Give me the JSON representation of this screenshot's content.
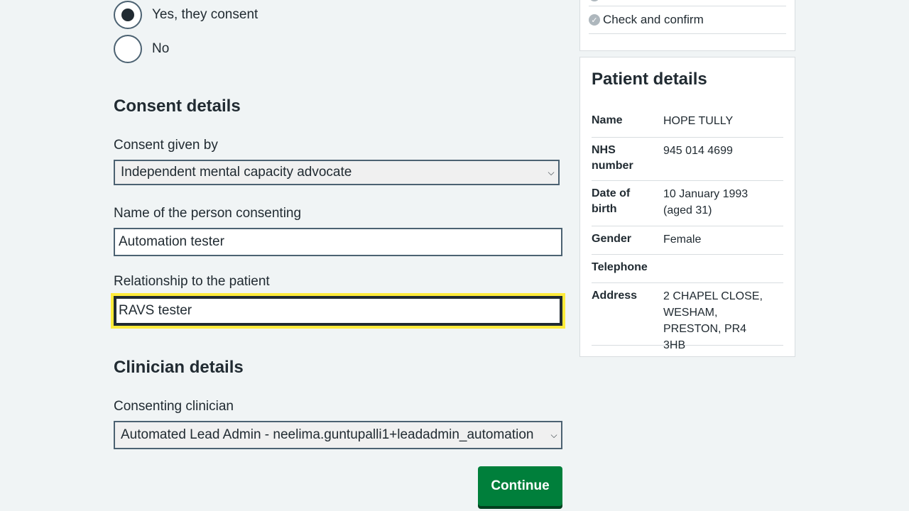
{
  "consent_options": [
    {
      "label": "Yes, they consent",
      "selected": true
    },
    {
      "label": "No",
      "selected": false
    }
  ],
  "consent_details": {
    "heading": "Consent details",
    "given_by_label": "Consent given by",
    "given_by_value": "Independent mental capacity advocate",
    "name_label": "Name of the person consenting",
    "name_value": "Automation tester",
    "relationship_label": "Relationship to the patient",
    "relationship_value": "RAVS tester"
  },
  "clinician_details": {
    "heading": "Clinician details",
    "clinician_label": "Consenting clinician",
    "clinician_value": "Automated Lead Admin - neelima.guntupalli1+leadadmin_automation"
  },
  "continue_label": "Continue",
  "task_list": {
    "last_item": "Check and confirm"
  },
  "patient": {
    "heading": "Patient details",
    "rows": [
      {
        "key": "Name",
        "value": "HOPE TULLY"
      },
      {
        "key": "NHS number",
        "value": "945 014 4699"
      },
      {
        "key": "Date of birth",
        "value": "10 January 1993 (aged 31)"
      },
      {
        "key": "Gender",
        "value": "Female"
      },
      {
        "key": "Telephone",
        "value": ""
      },
      {
        "key": "Address",
        "value": "2 CHAPEL CLOSE, WESHAM, PRESTON, PR4 3HB"
      }
    ]
  },
  "colors": {
    "primary_button": "#007f3b",
    "focus": "#ffeb3b",
    "background": "#f0f4f5"
  }
}
